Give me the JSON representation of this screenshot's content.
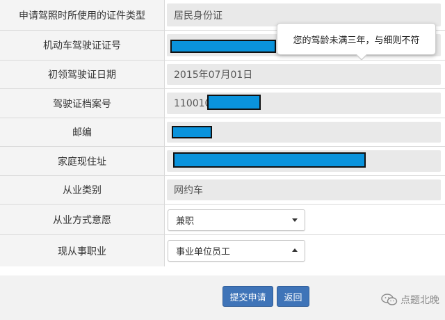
{
  "rows": [
    {
      "label": "申请驾照时所使用的证件类型",
      "value": "居民身份证"
    },
    {
      "label": "机动车驾驶证证号",
      "value": ""
    },
    {
      "label": "初领驾驶证日期",
      "value": "2015年07月01日"
    },
    {
      "label": "驾驶证档案号",
      "value": "110010"
    },
    {
      "label": "邮编",
      "value": ""
    },
    {
      "label": "家庭现住址",
      "value": ""
    },
    {
      "label": "从业类别",
      "value": "网约车"
    },
    {
      "label": "从业方式意愿",
      "value": "兼职"
    },
    {
      "label": "现从事职业",
      "value": "事业单位员工"
    }
  ],
  "tooltip": {
    "text": "您的驾龄未满三年，与细则不符"
  },
  "buttons": {
    "submit": "提交申请",
    "back": "返回"
  },
  "watermark": {
    "text": "点题北晚"
  },
  "colors": {
    "redaction": "#0a93dc",
    "button": "#3f74b8"
  }
}
